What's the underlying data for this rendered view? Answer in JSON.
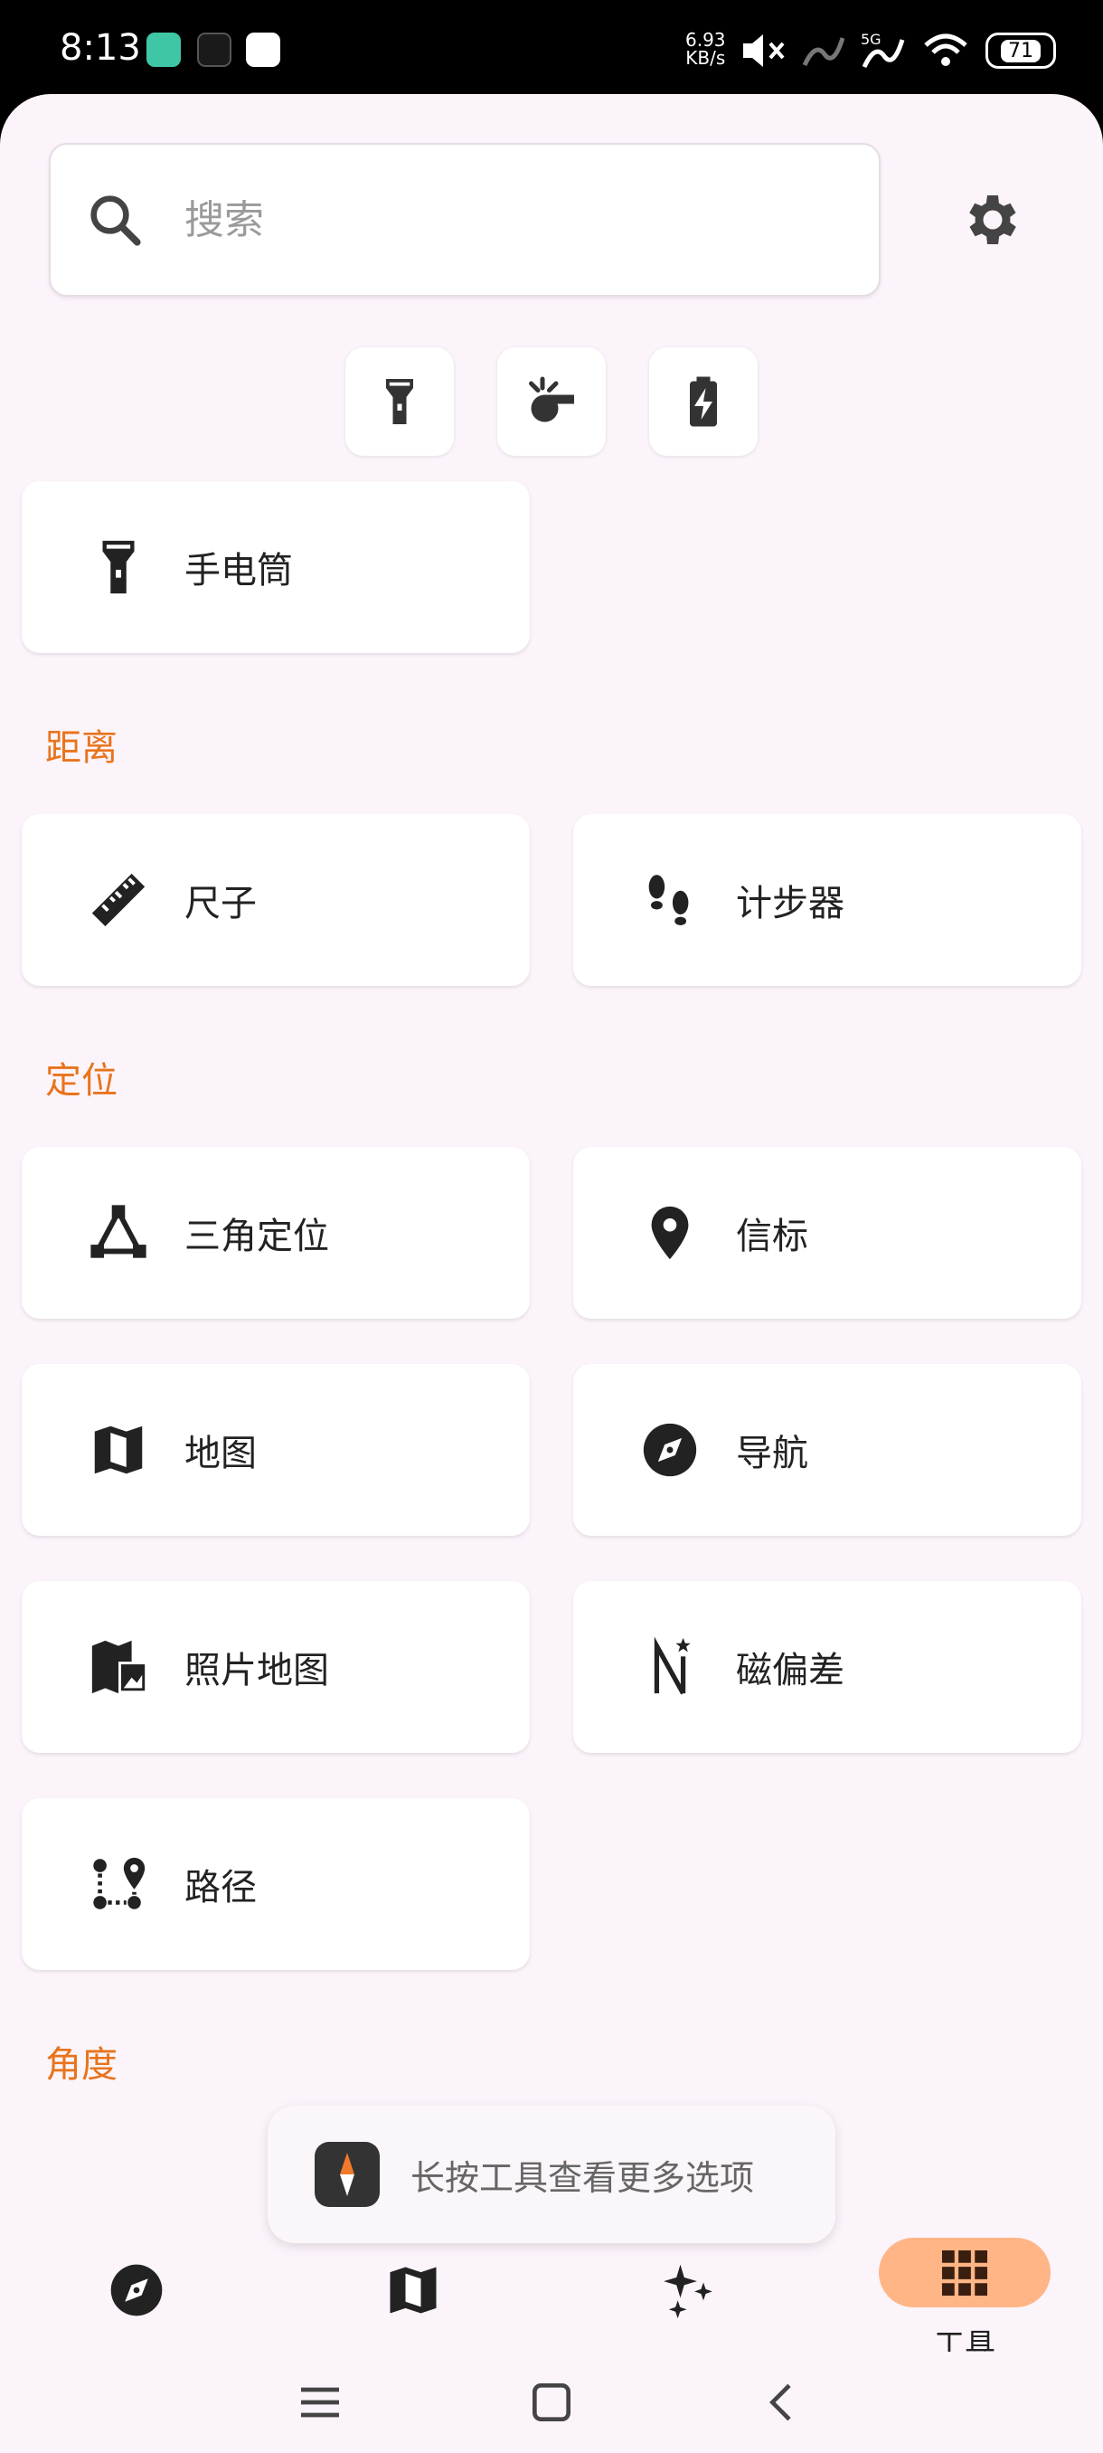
{
  "status_bar": {
    "time": "8:13",
    "net_speed_value": "6.93",
    "net_speed_unit": "KB/s",
    "network_type": "5G",
    "battery": "71"
  },
  "search": {
    "placeholder": "搜索"
  },
  "quick_actions": [
    {
      "icon": "flashlight-icon"
    },
    {
      "icon": "whistle-icon"
    },
    {
      "icon": "battery-charging-icon"
    }
  ],
  "pinned": [
    {
      "label": "手电筒",
      "icon": "flashlight-icon"
    }
  ],
  "sections": [
    {
      "title": "距离",
      "tools": [
        {
          "label": "尺子",
          "icon": "ruler-icon"
        },
        {
          "label": "计步器",
          "icon": "footsteps-icon"
        }
      ]
    },
    {
      "title": "定位",
      "tools": [
        {
          "label": "三角定位",
          "icon": "triangulate-icon"
        },
        {
          "label": "信标",
          "icon": "location-pin-icon"
        },
        {
          "label": "地图",
          "icon": "map-icon"
        },
        {
          "label": "导航",
          "icon": "compass-icon"
        },
        {
          "label": "照片地图",
          "icon": "photo-map-icon"
        },
        {
          "label": "磁偏差",
          "icon": "declination-icon"
        },
        {
          "label": "路径",
          "icon": "route-icon"
        }
      ]
    },
    {
      "title": "角度",
      "tools": []
    }
  ],
  "toast": {
    "text": "长按工具查看更多选项"
  },
  "bottom_nav": [
    {
      "icon": "compass-icon",
      "label": ""
    },
    {
      "icon": "map-icon",
      "label": ""
    },
    {
      "icon": "sparkles-icon",
      "label": ""
    },
    {
      "icon": "grid-icon",
      "label": "工具",
      "active": true
    }
  ],
  "colors": {
    "accent": "#e8741c",
    "active_pill": "#ffb586",
    "background": "#fcf4fb"
  }
}
